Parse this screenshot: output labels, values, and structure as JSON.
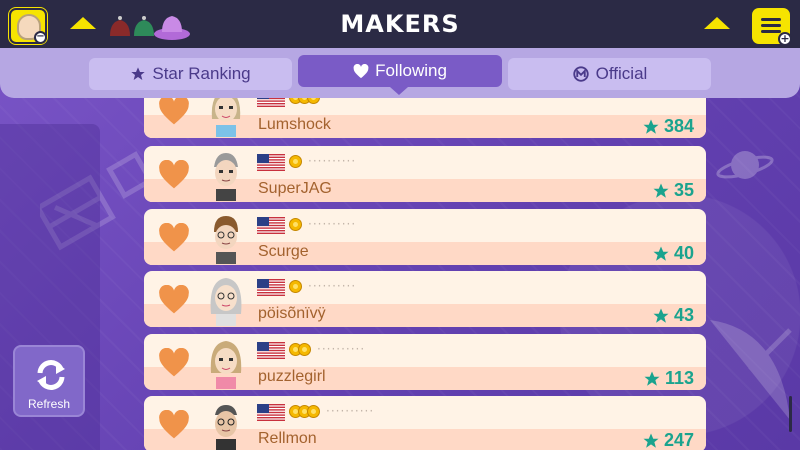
{
  "header": {
    "title": "MAKERS"
  },
  "tabs": [
    {
      "label": "Star Ranking",
      "icon": "star-icon",
      "selected": false
    },
    {
      "label": "Following",
      "icon": "heart-icon",
      "selected": true
    },
    {
      "label": "Official",
      "icon": "mario-logo-icon",
      "selected": false
    }
  ],
  "sidebar": {
    "refresh_label": "Refresh"
  },
  "makers": [
    {
      "name": "Lumshock",
      "stars": "384",
      "country": "US",
      "medals": 3
    },
    {
      "name": "SuperJAG",
      "stars": "35",
      "country": "US",
      "medals": 1
    },
    {
      "name": "Scurge",
      "stars": "40",
      "country": "US",
      "medals": 1
    },
    {
      "name": "pöisõnïvÿ",
      "stars": "43",
      "country": "US",
      "medals": 1
    },
    {
      "name": "puzzlegirl",
      "stars": "113",
      "country": "US",
      "medals": 2
    },
    {
      "name": "Rellmon",
      "stars": "247",
      "country": "US",
      "medals": 3
    }
  ],
  "colors": {
    "accent": "#7a5bc6",
    "topbar": "#2b2a45",
    "yellow": "#f6e400",
    "star_score": "#1aa38e",
    "heart": "#f0934a",
    "name_text": "#a3622e"
  }
}
